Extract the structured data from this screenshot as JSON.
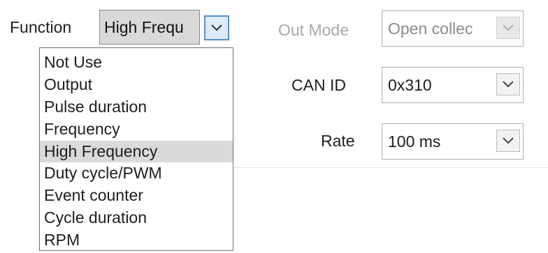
{
  "function": {
    "label": "Function",
    "selected_value": "High Frequ",
    "options": [
      "Not Use",
      "Output",
      "Pulse duration",
      "Frequency",
      "High Frequency",
      "Duty cycle/PWM",
      "Event counter",
      "Cycle duration",
      "RPM"
    ],
    "highlighted_option": "High Frequency"
  },
  "out_mode": {
    "label": "Out Mode",
    "value": "Open collec"
  },
  "can_id": {
    "label": "CAN ID",
    "value": "0x310"
  },
  "rate": {
    "label": "Rate",
    "value": "100 ms"
  },
  "colors": {
    "focus_border": "#4f93d1",
    "selection_bg": "#dadada",
    "disabled_text": "#a8a8a8"
  },
  "icons": {
    "dropdown_arrow": "chevron-down-icon"
  }
}
